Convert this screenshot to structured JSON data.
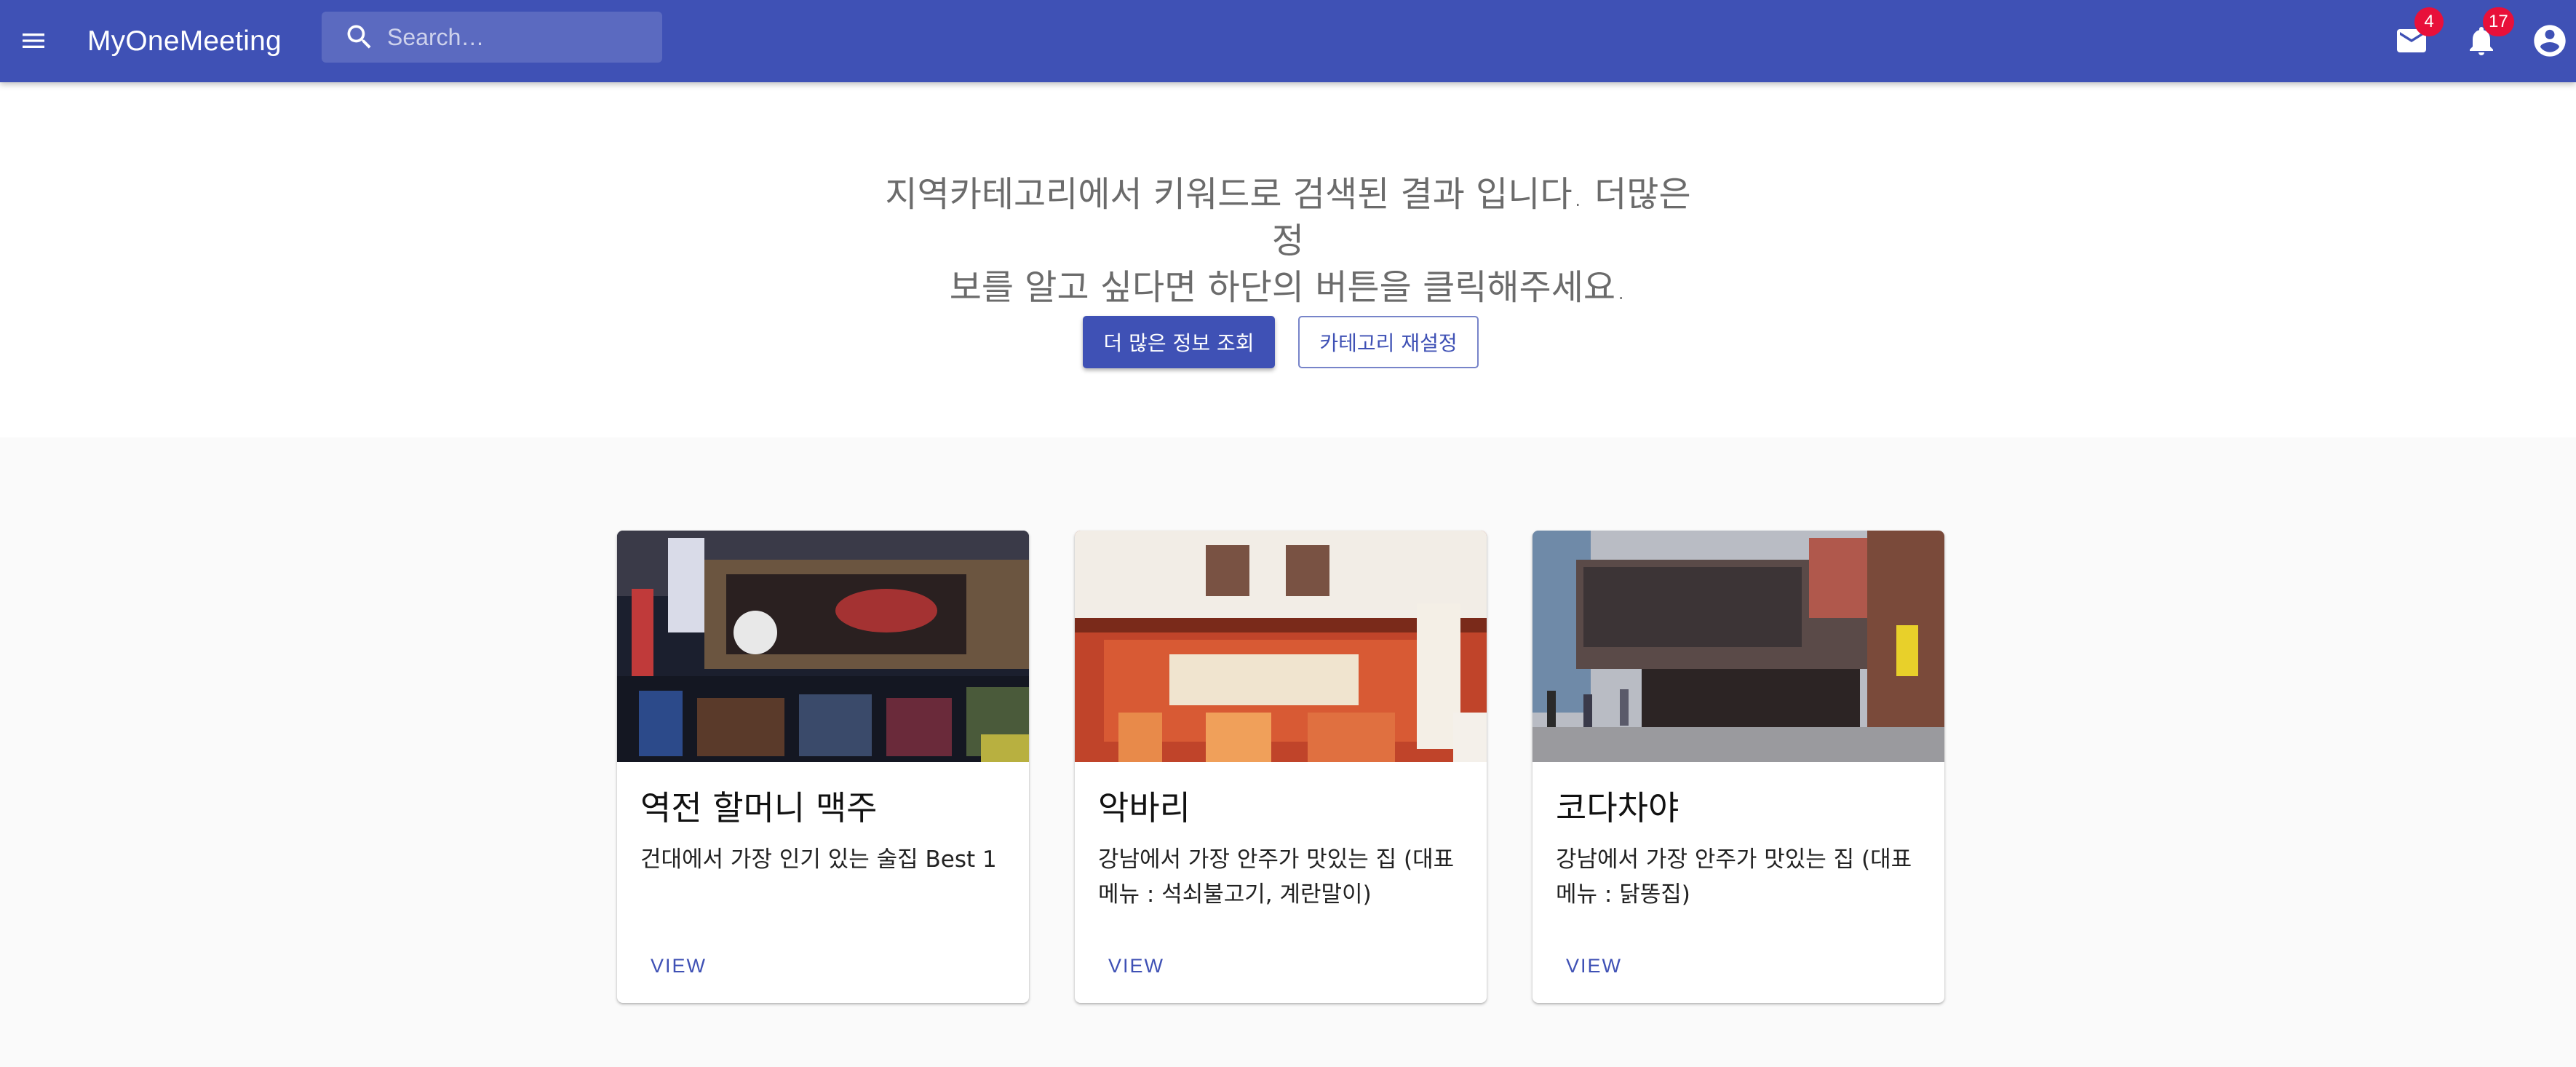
{
  "appbar": {
    "title": "MyOneMeeting",
    "search_placeholder": "Search…",
    "mail_badge": "4",
    "notifications_badge": "17",
    "color": "#3f51b5"
  },
  "hero": {
    "line1": "지역카테고리에서 키워드로 검색된 결과 입니다. 더많은 정",
    "line2": "보를 알고 싶다면 하단의 버튼을 클릭해주세요.",
    "primary_button": "더 많은 정보 조회",
    "secondary_button": "카테고리 재설정"
  },
  "cards": [
    {
      "title": "역전 할머니 맥주",
      "description": "건대에서 가장 인기 있는 술집 Best 1",
      "action": "VIEW"
    },
    {
      "title": "악바리",
      "description": "강남에서 가장 안주가 맛있는 집 (대표메뉴 : 석쇠불고기, 계란말이)",
      "action": "VIEW"
    },
    {
      "title": "코다차야",
      "description": "강남에서 가장 안주가 맛있는 집 (대표메뉴 : 닭똥집)",
      "action": "VIEW"
    }
  ],
  "icons": {
    "menu": "menu-icon",
    "search": "search-icon",
    "mail": "mail-icon",
    "notifications": "bell-icon",
    "account": "account-circle-icon"
  },
  "colors": {
    "primary": "#3f51b5",
    "badge": "#e8103a"
  }
}
